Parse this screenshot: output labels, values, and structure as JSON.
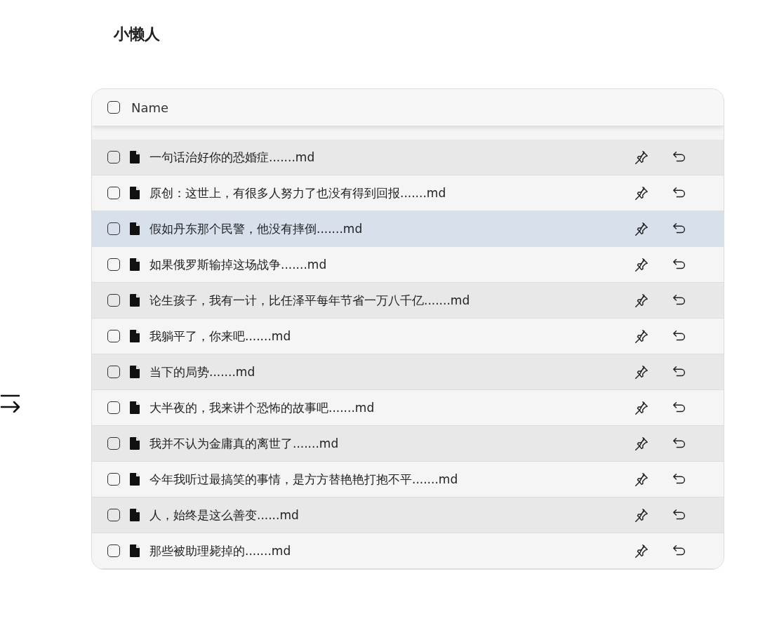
{
  "title": "小懒人",
  "table": {
    "header": {
      "checked": false,
      "label": "Name"
    },
    "rows": [
      {
        "name": "一句话治好你的恐婚症.......md",
        "checked": false,
        "selected": false
      },
      {
        "name": "原创：这世上，有很多人努力了也没有得到回报.......md",
        "checked": false,
        "selected": false
      },
      {
        "name": "假如丹东那个民警，他没有摔倒.......md",
        "checked": false,
        "selected": true
      },
      {
        "name": "如果俄罗斯输掉这场战争.......md",
        "checked": false,
        "selected": false
      },
      {
        "name": "论生孩子，我有一计，比任泽平每年节省一万八千亿.......md",
        "checked": false,
        "selected": false
      },
      {
        "name": "我躺平了，你来吧.......md",
        "checked": false,
        "selected": false
      },
      {
        "name": "当下的局势.......md",
        "checked": false,
        "selected": false
      },
      {
        "name": "大半夜的，我来讲个恐怖的故事吧.......md",
        "checked": false,
        "selected": false
      },
      {
        "name": "我并不认为金庸真的离世了.......md",
        "checked": false,
        "selected": false
      },
      {
        "name": "今年我听过最搞笑的事情，是方方替艳艳打抱不平.......md",
        "checked": false,
        "selected": false
      },
      {
        "name": "人，始终是这么善变......md",
        "checked": false,
        "selected": false
      },
      {
        "name": "那些被助理毙掉的.......md",
        "checked": false,
        "selected": false
      }
    ]
  }
}
